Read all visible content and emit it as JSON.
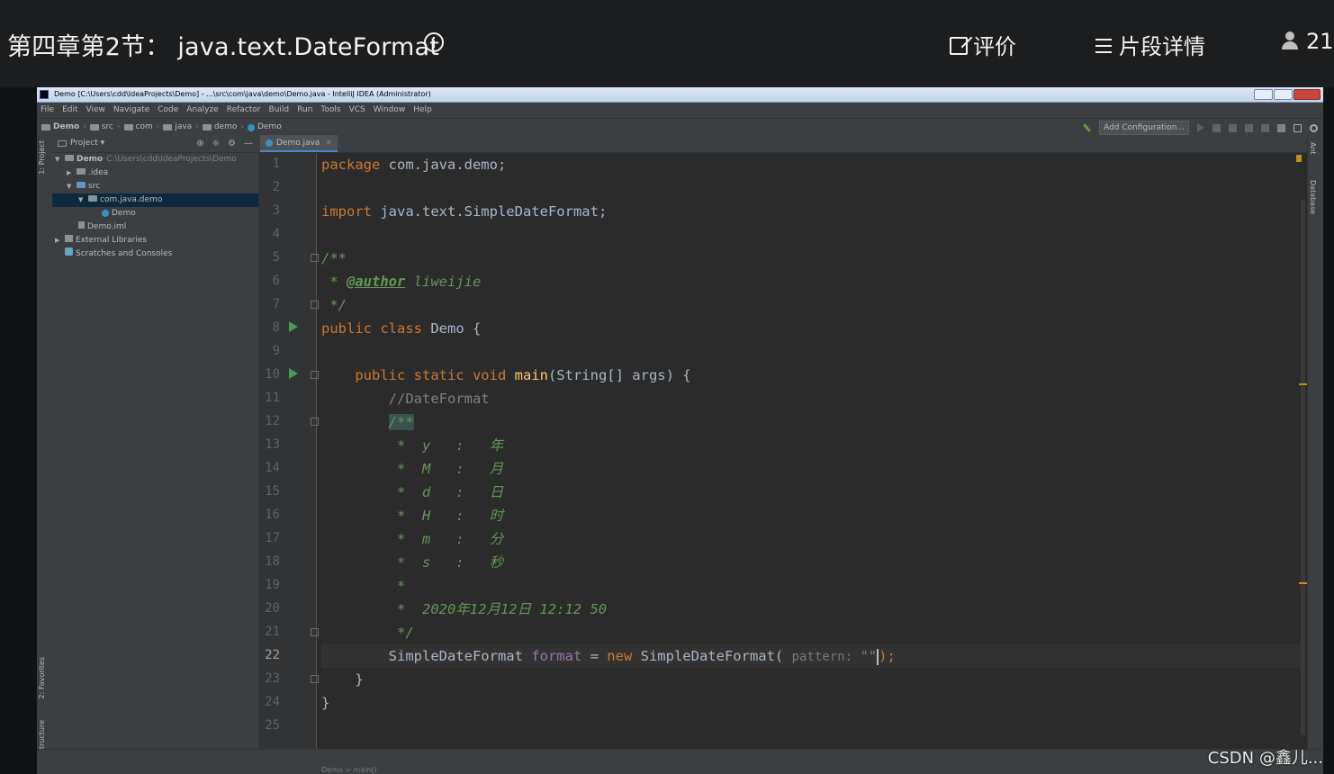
{
  "video_header": {
    "title": "第四章第2节：  java.text.DateFormat",
    "actions": {
      "rate": "评价",
      "details": "片段详情",
      "viewers": "21"
    }
  },
  "window": {
    "title": "Demo [C:\\Users\\cdd\\IdeaProjects\\Demo] - ...\\src\\com\\java\\demo\\Demo.java - IntelliJ IDEA (Administrator)"
  },
  "menu": [
    "File",
    "Edit",
    "View",
    "Navigate",
    "Code",
    "Analyze",
    "Refactor",
    "Build",
    "Run",
    "Tools",
    "VCS",
    "Window",
    "Help"
  ],
  "breadcrumbs": [
    "Demo",
    "src",
    "com",
    "java",
    "demo",
    "Demo"
  ],
  "toolbar": {
    "add_config": "Add Configuration..."
  },
  "left_tabs": {
    "project": "1: Project",
    "favorites": "2: Favorites",
    "structure": "Z: Structure"
  },
  "right_tabs": {
    "ant": "Ant",
    "database": "Database"
  },
  "project_panel": {
    "title": "Project",
    "tree": [
      {
        "label": "Demo",
        "path": "C:\\Users\\cdd\\IdeaProjects\\Demo"
      },
      {
        "label": ".idea"
      },
      {
        "label": "src"
      },
      {
        "label": "com.java.demo"
      },
      {
        "label": "Demo"
      },
      {
        "label": "Demo.iml"
      },
      {
        "label": "External Libraries"
      },
      {
        "label": "Scratches and Consoles"
      }
    ]
  },
  "editor": {
    "tab": "Demo.java",
    "current_line": 22,
    "code": {
      "l1_kw": "package ",
      "l1_rest": "com.java.demo;",
      "l3_kw": "import ",
      "l3_rest": "java.text.SimpleDateFormat;",
      "l5": "/**",
      "l6_star": " * ",
      "l6_tag": "@author",
      "l6_name": " liweijie",
      "l7": " */",
      "l8_kw": "public class ",
      "l8_rest": "Demo {",
      "l10_kw": "    public static void ",
      "l10_fn": "main",
      "l10_rest": "(String[] args) {",
      "l11": "        //DateFormat",
      "l12_indent": "        ",
      "l12": "/**",
      "l13": "         *  y   :   年",
      "l14": "         *  M   :   月",
      "l15": "         *  d   :   日",
      "l16": "         *  H   :   时",
      "l17": "         *  m   :   分",
      "l18": "         *  s   :   秒",
      "l19": "         *",
      "l20": "         *  2020年12月12日 12:12 50",
      "l21": "         */",
      "l22_type": "        SimpleDateFormat ",
      "l22_var": "format",
      "l22_eq": " = ",
      "l22_new": "new ",
      "l22_ctor": "SimpleDateFormat( ",
      "l22_hint": "pattern: ",
      "l22_str": "\"\"",
      "l22_end": ");",
      "l23": "    }",
      "l24": "}"
    }
  },
  "status_bar": {
    "breadcrumb": "Demo  >  main()"
  },
  "watermark": "CSDN @鑫儿...",
  "colors": {
    "keyword": "#cc7832",
    "plain": "#a9b7c6",
    "doc": "#629755",
    "method": "#ffc66d",
    "comment": "#808080"
  }
}
